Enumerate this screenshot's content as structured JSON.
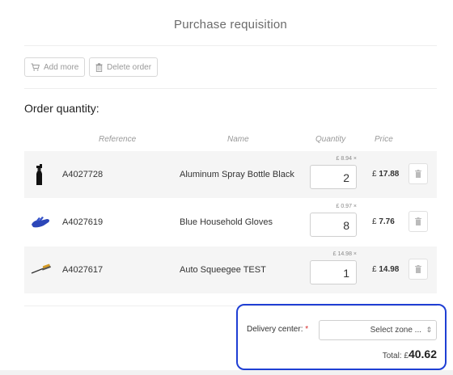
{
  "page": {
    "title": "Purchase requisition"
  },
  "toolbar": {
    "add_more": "Add more",
    "delete_order": "Delete order"
  },
  "section": {
    "title": "Order quantity:"
  },
  "table": {
    "headers": {
      "reference": "Reference",
      "name": "Name",
      "quantity": "Quantity",
      "price": "Price"
    },
    "rows": [
      {
        "reference": "A4027728",
        "name": "Aluminum Spray Bottle Black",
        "unit_price": "£ 8.94 ×",
        "quantity": "2",
        "currency": "£",
        "price": "17.88",
        "icon": "spray-bottle-icon"
      },
      {
        "reference": "A4027619",
        "name": "Blue Household Gloves",
        "unit_price": "£ 0.97 ×",
        "quantity": "8",
        "currency": "£",
        "price": "7.76",
        "icon": "gloves-icon"
      },
      {
        "reference": "A4027617",
        "name": "Auto Squeegee TEST",
        "unit_price": "£ 14.98 ×",
        "quantity": "1",
        "currency": "£",
        "price": "14.98",
        "icon": "squeegee-icon"
      }
    ]
  },
  "delivery": {
    "label": "Delivery center:",
    "required_mark": "*",
    "select_value": "Select zone ...",
    "arrow": "⇕"
  },
  "total": {
    "label": "Total: £",
    "value": "40.62"
  },
  "colors": {
    "highlight": "#1f3fd4",
    "required": "#d62b2b"
  }
}
